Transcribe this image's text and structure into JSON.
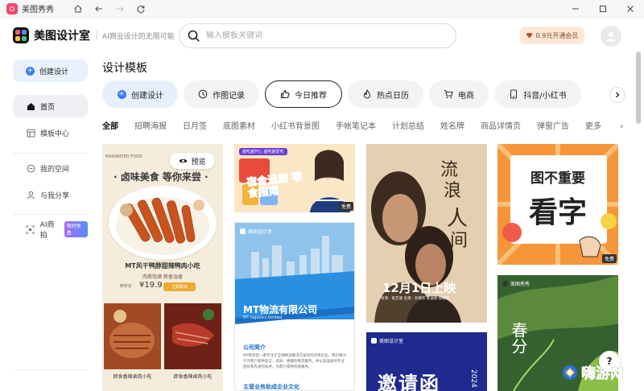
{
  "window": {
    "title": "美图秀秀"
  },
  "brand": {
    "name": "美图设计室",
    "slogan": "AI商业设计的无限可能"
  },
  "search": {
    "placeholder": "输入模板关键词"
  },
  "vip": {
    "label": "0.9元开通会员"
  },
  "sidebar": {
    "create": "创建设计",
    "items": [
      {
        "label": "首页",
        "icon": "home-icon"
      },
      {
        "label": "模板中心",
        "icon": "template-icon"
      },
      {
        "label": "我的空间",
        "icon": "space-icon"
      },
      {
        "label": "与我分享",
        "icon": "share-icon"
      },
      {
        "label": "AI商拍",
        "icon": "ai-icon",
        "badge": "限时免费"
      }
    ]
  },
  "main": {
    "title": "设计模板",
    "chips": [
      {
        "label": "创建设计",
        "icon": "plus-icon"
      },
      {
        "label": "作图记录",
        "icon": "clock-icon"
      },
      {
        "label": "今日推荐",
        "icon": "thumbs-up-icon"
      },
      {
        "label": "热点日历",
        "icon": "fire-icon"
      },
      {
        "label": "电商",
        "icon": "cart-icon"
      },
      {
        "label": "抖音/小红书",
        "icon": "phone-icon"
      }
    ],
    "categories": [
      "全部",
      "招聘海报",
      "日月签",
      "底图素材",
      "小红书背景图",
      "手帐笔记本",
      "计划总结",
      "姓名牌",
      "商品详情页",
      "弹窗广告",
      "更多"
    ],
    "active_category": "全部"
  },
  "cards": {
    "food": {
      "preview": "预览",
      "tag": "MARINATED FOOD",
      "headline": "· 卤味美食 等你来尝 ·",
      "title": "MT风干鸭脖甜辣鸭肉小吃",
      "sub": "肉质饱满  新香溢香",
      "price_label": "到手价",
      "price": "¥19.9",
      "buy": "立即购买",
      "bottom_left": "即食香辣卤肉小吃",
      "bottom_right": "即食香辣卤肉小吃"
    },
    "snack": {
      "top": "越吃越开心 越吃越爱吃",
      "title": "宿舍追剧 零食指南",
      "free": "免费"
    },
    "logistics": {
      "brand": "美图设计室",
      "title": "MT物流有限公司",
      "sub": "MT logistics limited",
      "intro_title": "公司简介",
      "intro_text": "MT物流是一家专注于全球物流解决方案的综合性企业。我们致力于为客户提供安全、高效、便捷的物流服务，并以高品质的专业团队和先进的技术，为客户提供优质服务。",
      "footer": "主营业务助成企业文化"
    },
    "movie": {
      "title_a": "流",
      "title_b": "浪",
      "title_c": "人",
      "title_d": "间",
      "release": "12月1日上映",
      "credits": "导演：张艺谋  主演：刘德华  陈道明  梁朝伟"
    },
    "invite": {
      "brand": "美图设计室",
      "title": "邀请函",
      "year": "2024"
    },
    "sticker": {
      "line1": "图不重要",
      "line2": "看字",
      "free": "免费"
    },
    "spring": {
      "brand": "美图秀秀",
      "title": "春分"
    }
  },
  "watermark": {
    "text": "嗨游网"
  },
  "colors": {
    "accent": "#3d7ff0",
    "vip_bg": "#fde7d6",
    "vip_text": "#8a4b27"
  }
}
